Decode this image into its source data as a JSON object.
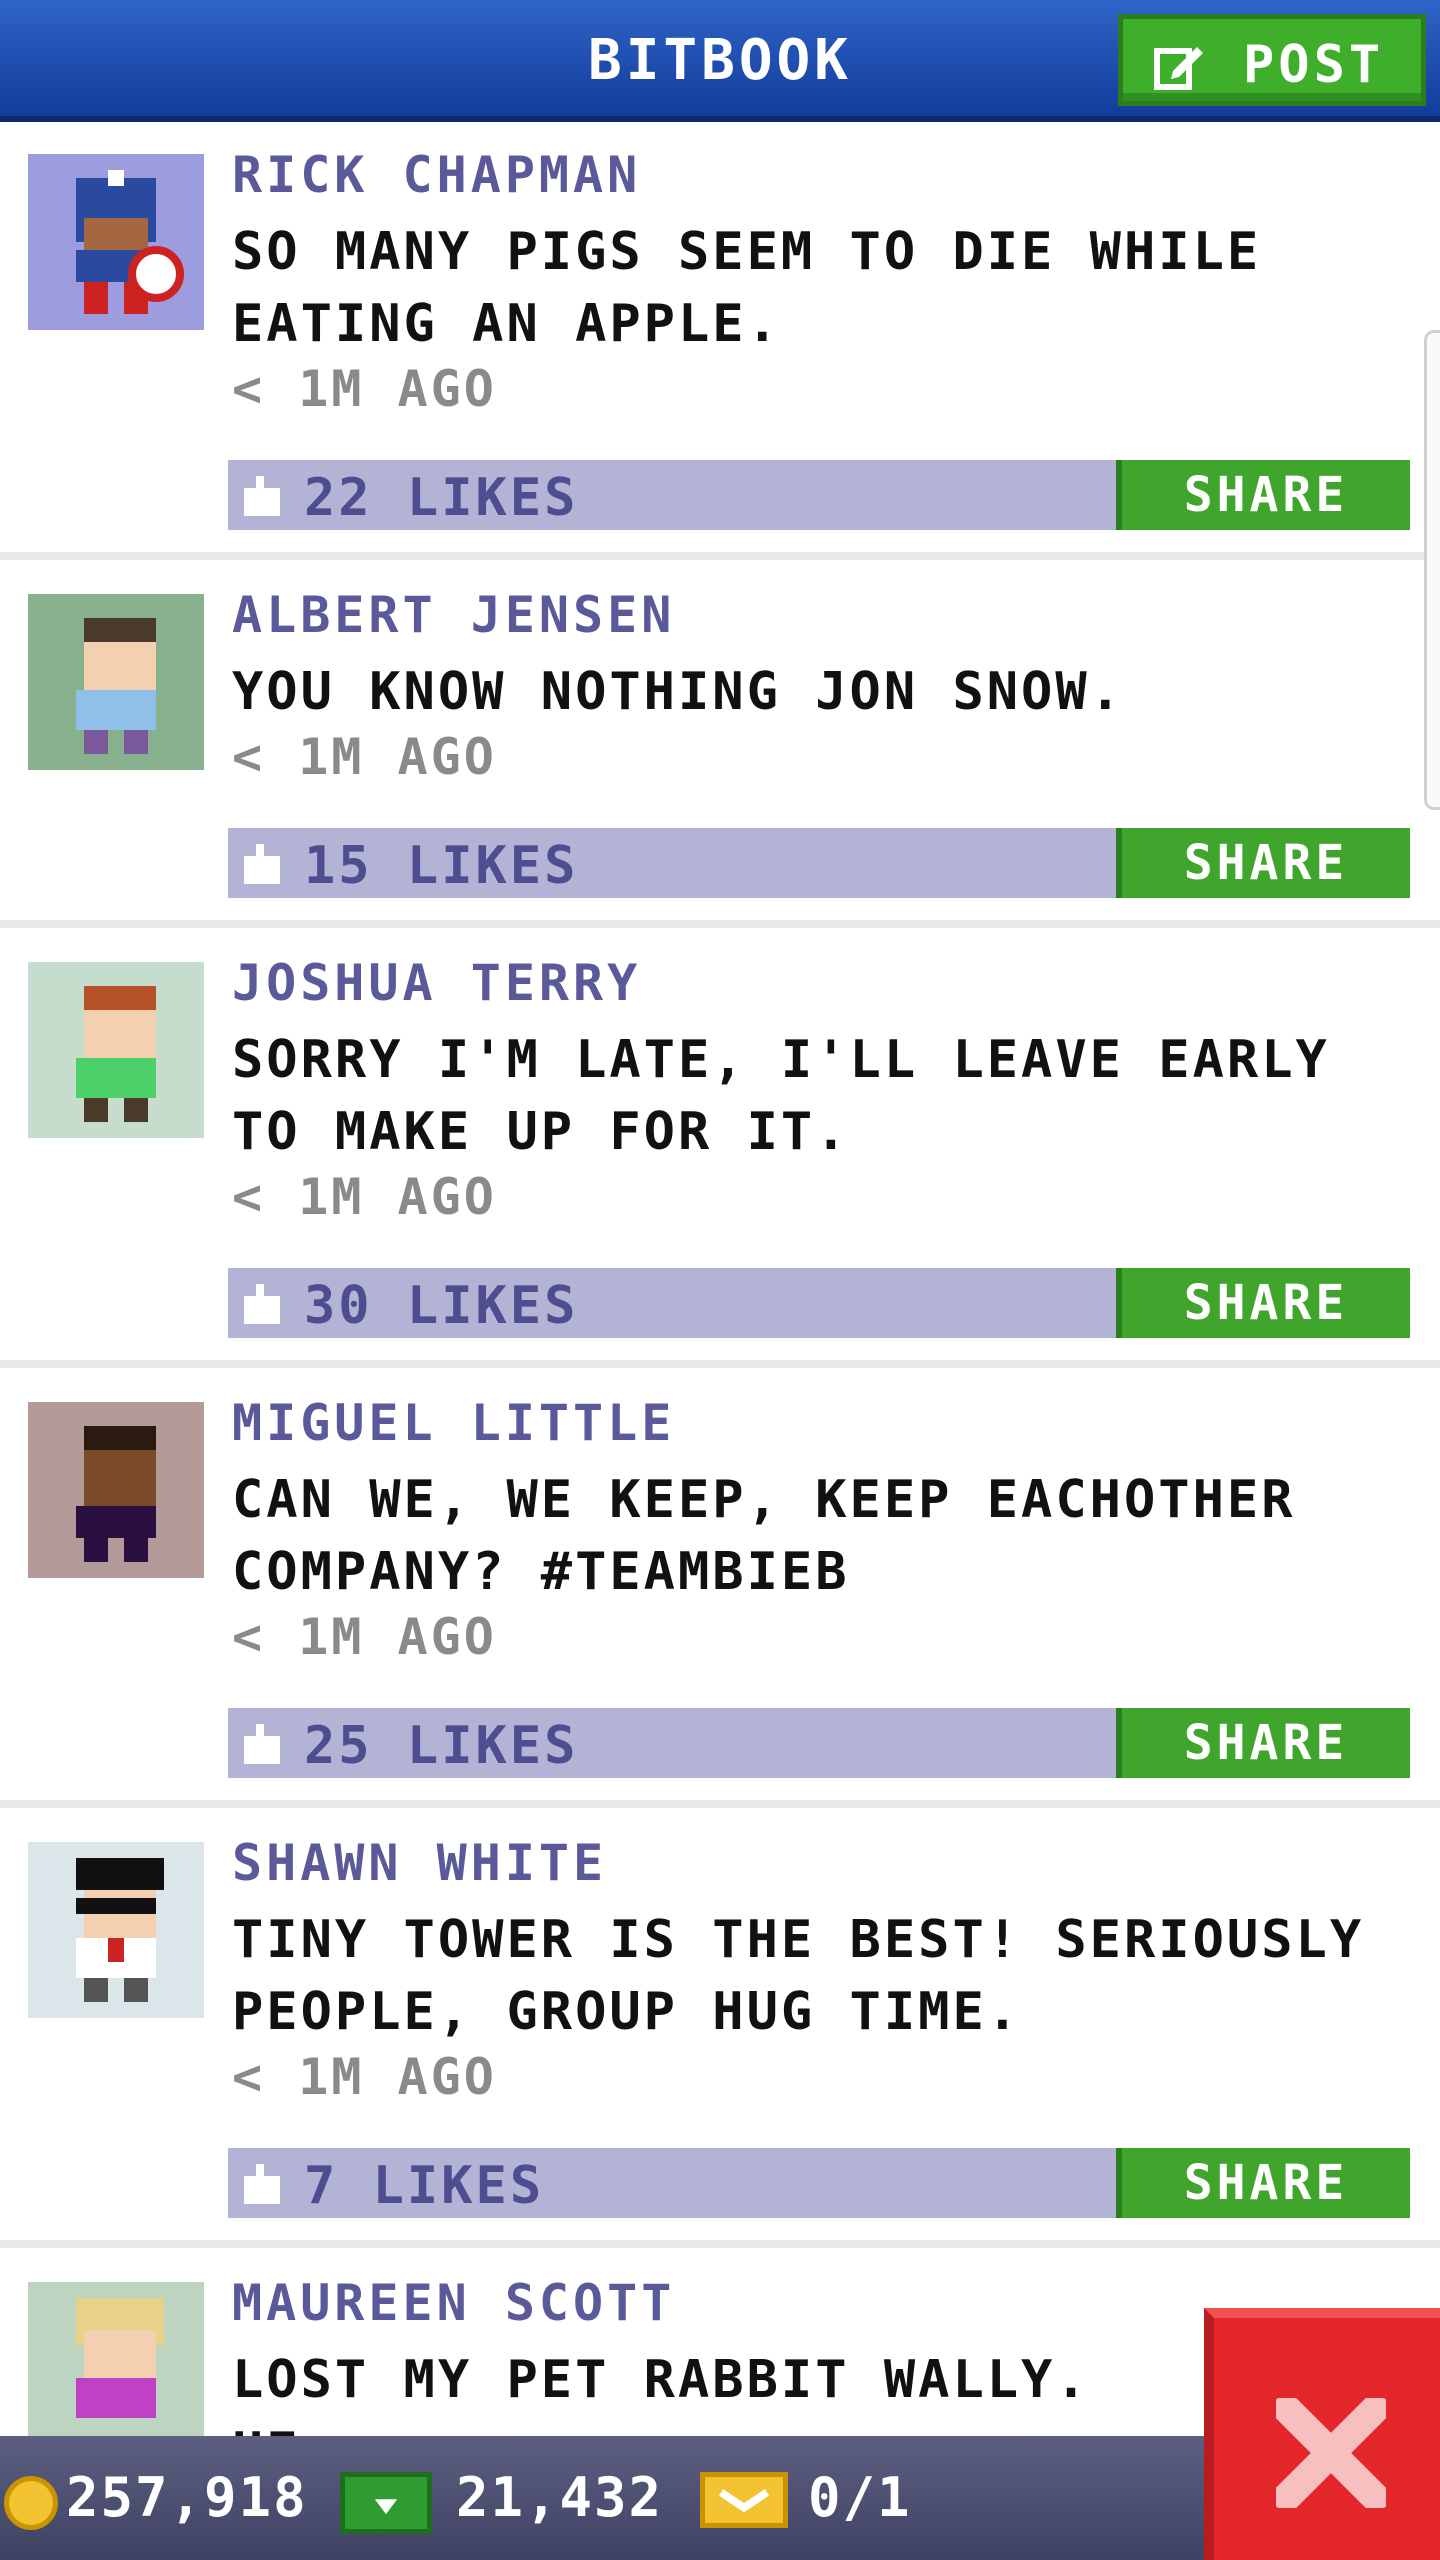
{
  "header": {
    "title": "BITBOOK",
    "post_label": "POST"
  },
  "posts": [
    {
      "name": "RICK CHAPMAN",
      "text": "SO MANY PIGS SEEM TO DIE WHILE EATING AN APPLE.",
      "time": "< 1M AGO",
      "likes": "22 LIKES",
      "share": "SHARE",
      "avatar_bg": "#9c9cde"
    },
    {
      "name": "ALBERT JENSEN",
      "text": "YOU KNOW NOTHING JON SNOW.",
      "time": "< 1M AGO",
      "likes": "15 LIKES",
      "share": "SHARE",
      "avatar_bg": "#86b08e"
    },
    {
      "name": "JOSHUA TERRY",
      "text": "SORRY I'M LATE, I'LL LEAVE EARLY TO MAKE UP FOR IT.",
      "time": "< 1M AGO",
      "likes": "30 LIKES",
      "share": "SHARE",
      "avatar_bg": "#c6dccc"
    },
    {
      "name": "MIGUEL LITTLE",
      "text": "CAN WE, WE KEEP, KEEP EACHOTHER COMPANY? #TEAMBIEB",
      "time": "< 1M AGO",
      "likes": "25 LIKES",
      "share": "SHARE",
      "avatar_bg": "#b49a98"
    },
    {
      "name": "SHAWN WHITE",
      "text": "TINY TOWER IS THE BEST! SERIOUSLY PEOPLE, GROUP HUG TIME.",
      "time": "< 1M AGO",
      "likes": "7 LIKES",
      "share": "SHARE",
      "avatar_bg": "#dce6ea"
    },
    {
      "name": "MAUREEN SCOTT",
      "text": "LOST MY PET RABBIT WALLY. HE",
      "time": "",
      "likes": "",
      "share": "",
      "avatar_bg": "#bcd4c0"
    }
  ],
  "status": {
    "coins": "257,918",
    "bux": "21,432",
    "vip": "0/1"
  },
  "colors": {
    "header_blue": "#1e4fb0",
    "share_green": "#3fa52d",
    "like_bar": "#b3b3d6",
    "close_red": "#e2262a"
  },
  "icons": [
    "edit-icon",
    "thumbs-up-icon",
    "coin-icon",
    "cash-icon",
    "gold-ticket-icon",
    "close-icon"
  ]
}
